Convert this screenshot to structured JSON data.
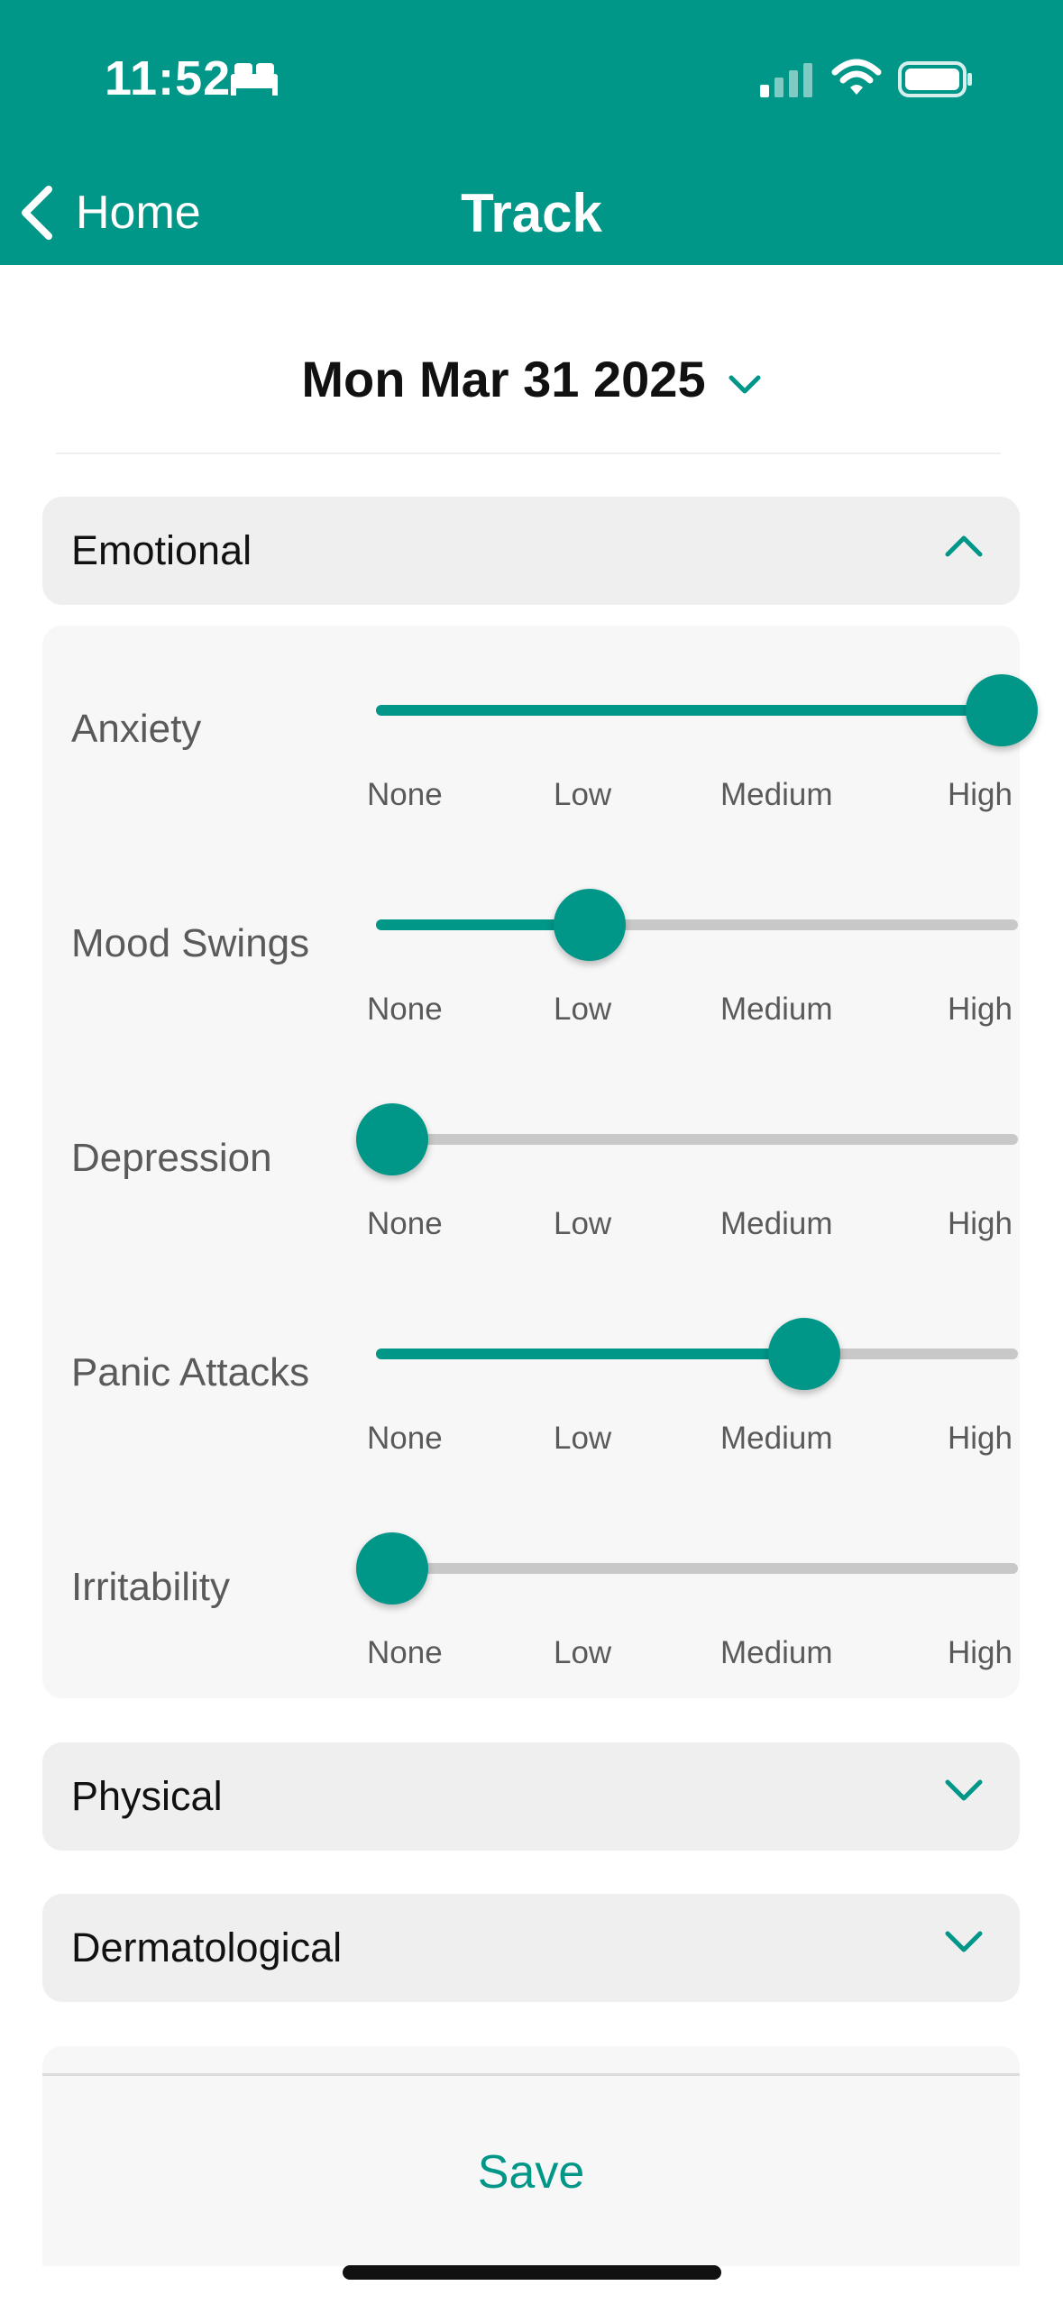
{
  "status_bar": {
    "time": "11:52",
    "icons": [
      "bed-icon",
      "cellular-signal-icon",
      "wifi-icon",
      "battery-icon"
    ]
  },
  "nav": {
    "back_label": "Home",
    "title": "Track"
  },
  "date_picker": {
    "value": "Mon Mar 31 2025"
  },
  "colors": {
    "accent": "#009688",
    "track_inactive": "#c8c8c8",
    "section_bg": "#efefef",
    "panel_bg": "#f7f7f7"
  },
  "scale_labels": [
    "None",
    "Low",
    "Medium",
    "High"
  ],
  "sections": [
    {
      "title": "Emotional",
      "expanded": true,
      "items": [
        {
          "label": "Anxiety",
          "value": "High",
          "level": 1.0
        },
        {
          "label": "Mood Swings",
          "value": "Low",
          "level": 0.333
        },
        {
          "label": "Depression",
          "value": "None",
          "level": 0.0
        },
        {
          "label": "Panic Attacks",
          "value": "Medium",
          "level": 0.667
        },
        {
          "label": "Irritability",
          "value": "None",
          "level": 0.0
        }
      ]
    },
    {
      "title": "Physical",
      "expanded": false
    },
    {
      "title": "Dermatological",
      "expanded": false
    }
  ],
  "save_label": "Save"
}
